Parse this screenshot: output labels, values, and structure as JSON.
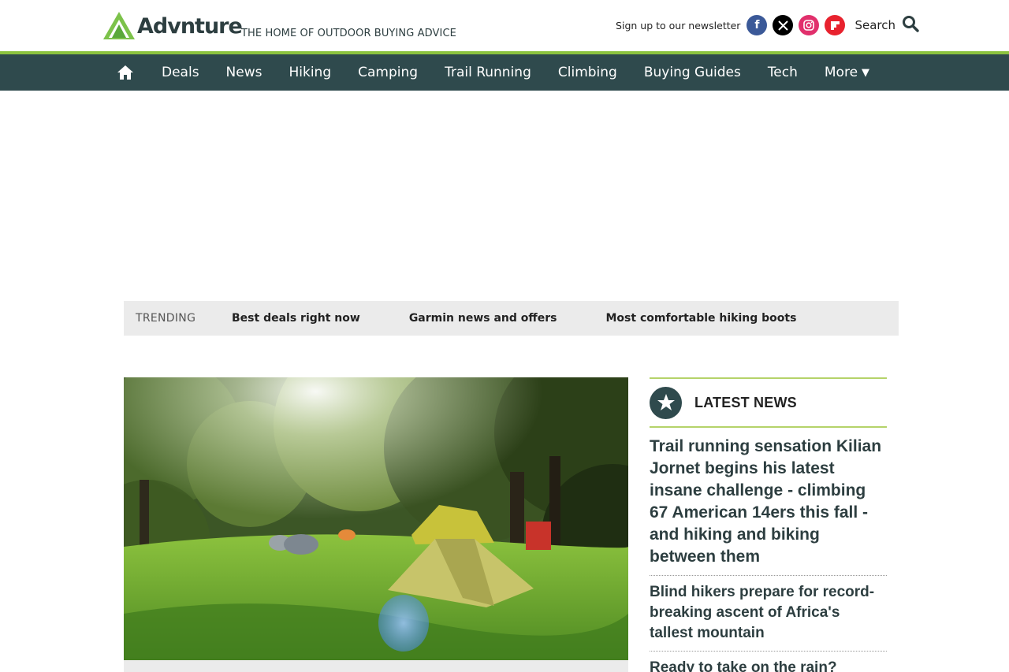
{
  "brand": {
    "name": "Advnture",
    "tagline": "THE HOME OF OUTDOOR BUYING ADVICE"
  },
  "header": {
    "newsletter_label": "Sign up to our newsletter",
    "social": [
      "facebook-icon",
      "x-icon",
      "instagram-icon",
      "flipboard-icon"
    ],
    "search_label": "Search"
  },
  "nav": {
    "items": [
      "Deals",
      "News",
      "Hiking",
      "Camping",
      "Trail Running",
      "Climbing",
      "Buying Guides",
      "Tech"
    ],
    "more_label": "More"
  },
  "trending": {
    "label": "TRENDING",
    "links": [
      "Best deals right now",
      "Garmin news and offers",
      "Most comfortable hiking boots"
    ]
  },
  "latest": {
    "title": "LATEST NEWS",
    "items": [
      "Trail running sensation Kilian Jornet begins his latest insane challenge - climbing 67 American 14ers this fall - and hiking and biking between them",
      "Blind hikers prepare for record-breaking ascent of Africa's tallest mountain",
      "Ready to take on the rain?"
    ]
  },
  "colors": {
    "nav_bg": "#2f4a4d",
    "accent_green": "#8bc33f",
    "trending_bg": "#ebebeb"
  }
}
